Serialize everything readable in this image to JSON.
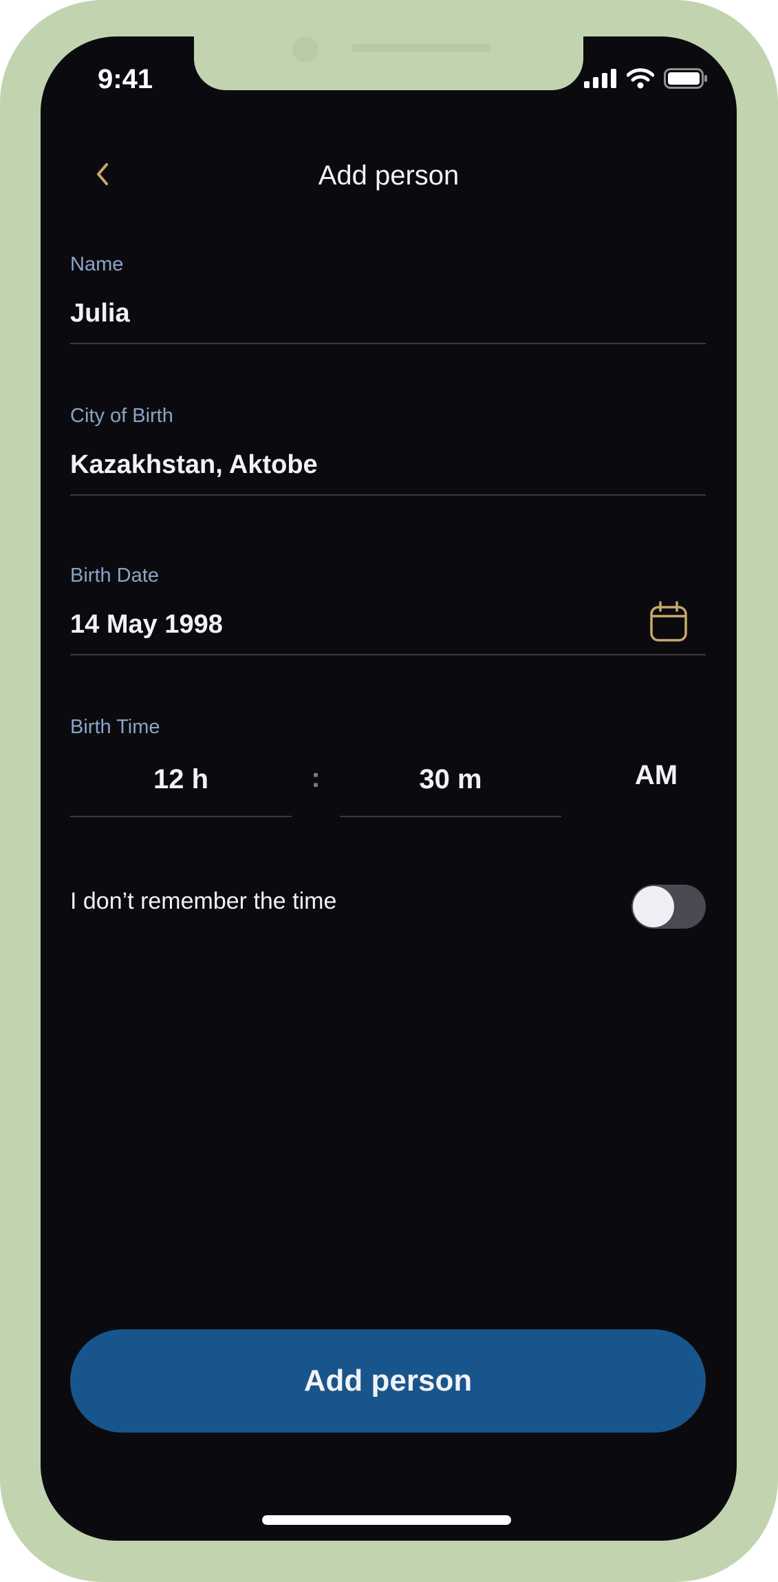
{
  "status_bar": {
    "time": "9:41"
  },
  "header": {
    "title": "Add person",
    "back_icon": "chevron-left-icon"
  },
  "form": {
    "name": {
      "label": "Name",
      "value": "Julia"
    },
    "city_of_birth": {
      "label": "City of Birth",
      "value": "Kazakhstan, Aktobe"
    },
    "birth_date": {
      "label": "Birth Date",
      "value": "14 May 1998",
      "icon": "calendar-icon"
    },
    "birth_time": {
      "label": "Birth Time",
      "hours": "12 h",
      "separator": ":",
      "minutes": "30 m",
      "period": "AM"
    },
    "dont_remember_time": {
      "label": "I don’t remember the time",
      "checked": false
    }
  },
  "actions": {
    "submit_label": "Add person"
  },
  "colors": {
    "background": "#0b0b0f",
    "accent_gold": "#c9a96a",
    "label_blue": "#8aa4c8",
    "primary_button": "#18558c",
    "device_frame": "#c2d3b0"
  }
}
